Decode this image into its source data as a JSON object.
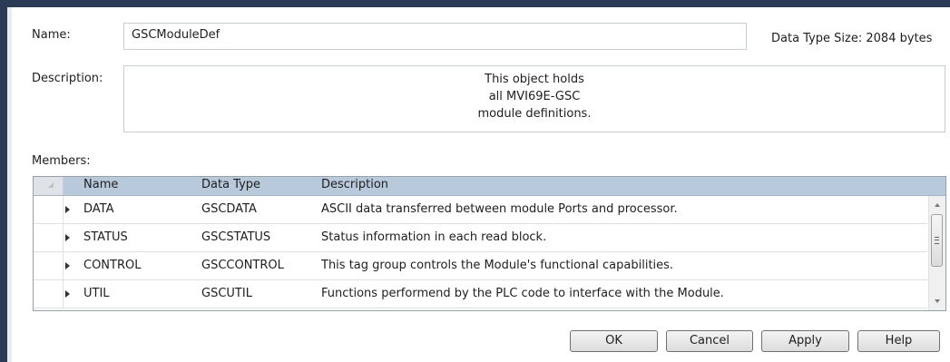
{
  "form": {
    "name_label": "Name:",
    "name_value": "GSCModuleDef",
    "size_label": "Data Type Size:",
    "size_value": "2084 bytes",
    "description_label": "Description:",
    "description_lines": [
      "This object holds",
      "all MVI69E-GSC",
      "module definitions."
    ],
    "members_label": "Members:"
  },
  "members": {
    "columns": [
      "Name",
      "Data Type",
      "Description"
    ],
    "rows": [
      {
        "name": "DATA",
        "type": "GSCDATA",
        "description": "ASCII data transferred between module Ports and processor."
      },
      {
        "name": "STATUS",
        "type": "GSCSTATUS",
        "description": "Status information in each read block."
      },
      {
        "name": "CONTROL",
        "type": "GSCCONTROL",
        "description": "This tag group controls the Module's functional capabilities."
      },
      {
        "name": "UTIL",
        "type": "GSCUTIL",
        "description": "Functions performend by the PLC code to interface with the Module."
      }
    ]
  },
  "buttons": {
    "ok": "OK",
    "cancel": "Cancel",
    "apply": "Apply",
    "help": "Help"
  },
  "icons": {
    "expander": "expand-arrow-icon",
    "scroll_up": "scroll-up-icon",
    "scroll_down": "scroll-down-icon"
  },
  "colors": {
    "header_bg": "#b9c9dc",
    "window_frame": "#2b3a55"
  }
}
